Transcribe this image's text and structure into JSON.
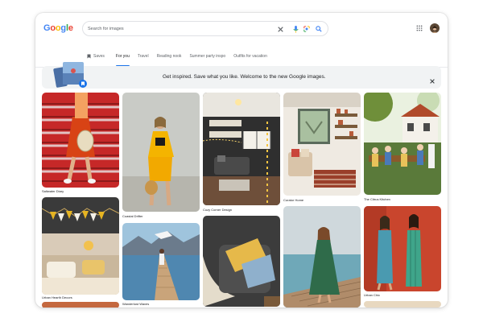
{
  "brand": {
    "logo_letters": [
      "G",
      "o",
      "o",
      "g",
      "l",
      "e"
    ],
    "logo_colors": [
      "#4285f4",
      "#ea4335",
      "#fbbc05",
      "#4285f4",
      "#34a853",
      "#ea4335"
    ]
  },
  "search": {
    "placeholder": "Search for images",
    "value": ""
  },
  "icons": {
    "clear": "close-icon",
    "mic": "mic-icon",
    "lens": "lens-icon",
    "search": "search-icon",
    "apps": "apps-grid-icon",
    "saves": "bookmark-icon"
  },
  "tabs": [
    {
      "label": "Saves"
    },
    {
      "label": "For you"
    },
    {
      "label": "Travel"
    },
    {
      "label": "Reading nook"
    },
    {
      "label": "Summer party inspo"
    },
    {
      "label": "Outfits for vacation"
    }
  ],
  "banner": {
    "text": "Get inspired. Save what you like. Welcome to the new Google images."
  },
  "cards": [
    {
      "caption": "Saltwater Diary"
    },
    {
      "caption": "Coastal Drifter"
    },
    {
      "caption": "Cozy Corner Design"
    },
    {
      "caption": "Curator Home"
    },
    {
      "caption": "The Citrus Kitchen"
    },
    {
      "caption": "Urban Hearth Decors"
    },
    {
      "caption": ""
    },
    {
      "caption": "Wanderlust Waves"
    },
    {
      "caption": ""
    },
    {
      "caption": ""
    },
    {
      "caption": "Urban Chic"
    }
  ],
  "colors": {
    "accent": "#1a73e8",
    "banner_bg": "#f1f3f4"
  }
}
